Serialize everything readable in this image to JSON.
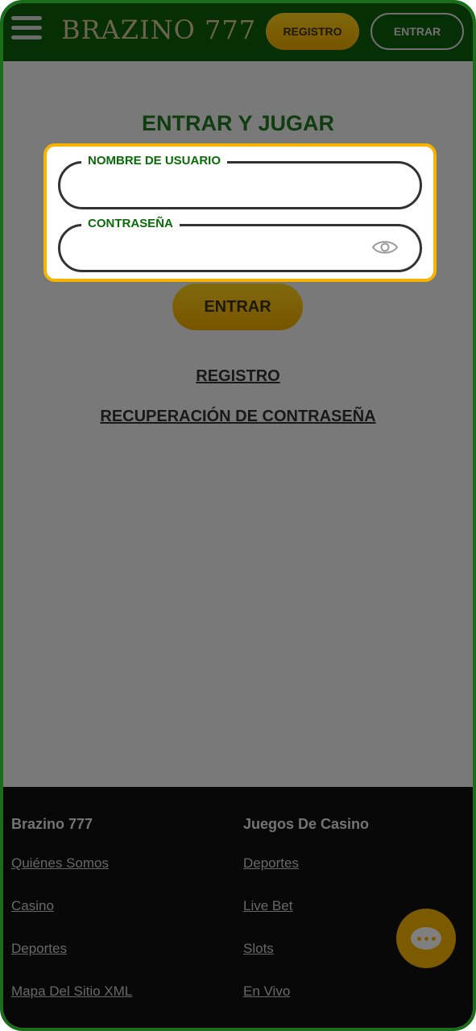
{
  "header": {
    "logo": "BRAZINO 777",
    "register_button": "REGISTRO",
    "login_button": "ENTRAR"
  },
  "main": {
    "title": "ENTRAR Y JUGAR",
    "username_label": "NOMBRE DE USUARIO",
    "password_label": "CONTRASEÑA",
    "submit_button": "ENTRAR",
    "register_link": "REGISTRO",
    "recover_link": "RECUPERACIÓN DE CONTRASEÑA"
  },
  "footer": {
    "col1": {
      "heading": "Brazino 777",
      "links": [
        "Quiénes Somos",
        "Casino",
        "Deportes",
        "Mapa Del Sitio XML"
      ]
    },
    "col2": {
      "heading": "Juegos De Casino",
      "links": [
        "Deportes",
        "Live Bet",
        "Slots",
        "En Vivo"
      ]
    }
  },
  "icons": {
    "menu": "hamburger-icon",
    "eye": "eye-icon",
    "chat": "chat-icon"
  },
  "colors": {
    "brand_green": "#0d5e0d",
    "accent_yellow": "#f5b400"
  }
}
